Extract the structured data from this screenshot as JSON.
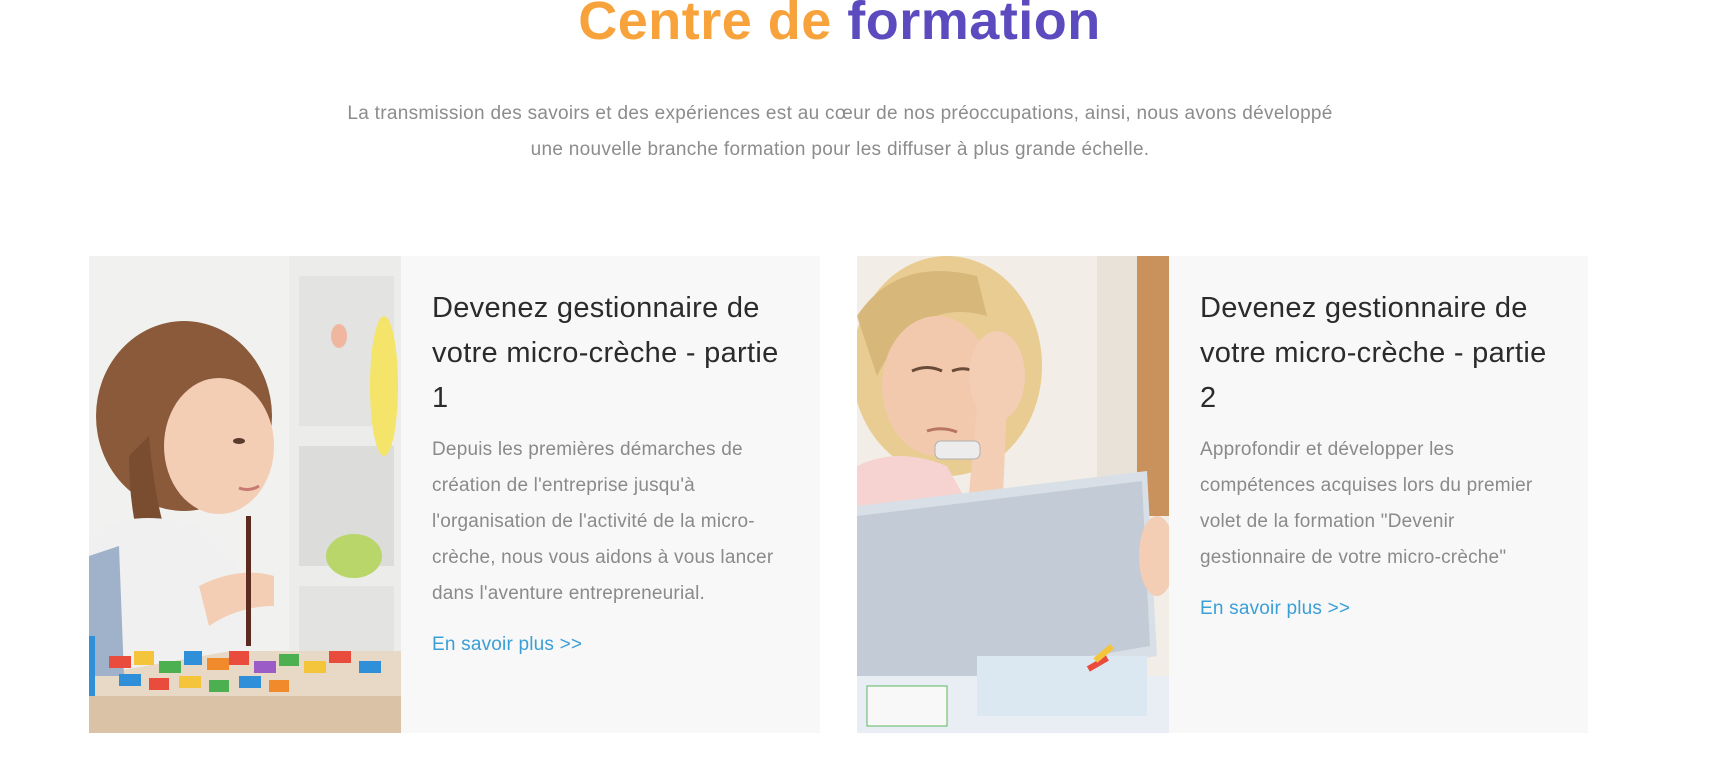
{
  "section": {
    "title_part_1": "Centre de",
    "title_part_2": "formation",
    "intro": "La transmission des savoirs et des expériences est au cœur de nos préoccupations, ainsi, nous avons développé une nouvelle branche formation pour les diffuser à plus grande échelle."
  },
  "cards": [
    {
      "title": "Devenez gestionnaire de votre micro-crèche - partie 1",
      "description": "Depuis les premières démarches de création de l'entreprise jusqu'à l'organisation de l'activité de la micro-crèche, nous vous aidons à vous lancer dans l'aventure entrepreneurial.",
      "link_label": "En savoir plus >>",
      "image": "woman-playing-with-puzzle-pieces-photo"
    },
    {
      "title": "Devenez gestionnaire de votre micro-crèche - partie 2",
      "description": "Approfondir et développer les compétences acquises lors du premier volet de la formation \"Devenir gestionnaire de votre micro-crèche\"",
      "link_label": "En savoir plus >>",
      "image": "woman-looking-at-laptop-photo"
    }
  ],
  "colors": {
    "title_accent_orange": "#f7a23b",
    "title_accent_purple": "#5b4bbf",
    "link": "#3a9fd6",
    "card_background": "#f8f8f8",
    "body_text": "#8a8a8a"
  }
}
